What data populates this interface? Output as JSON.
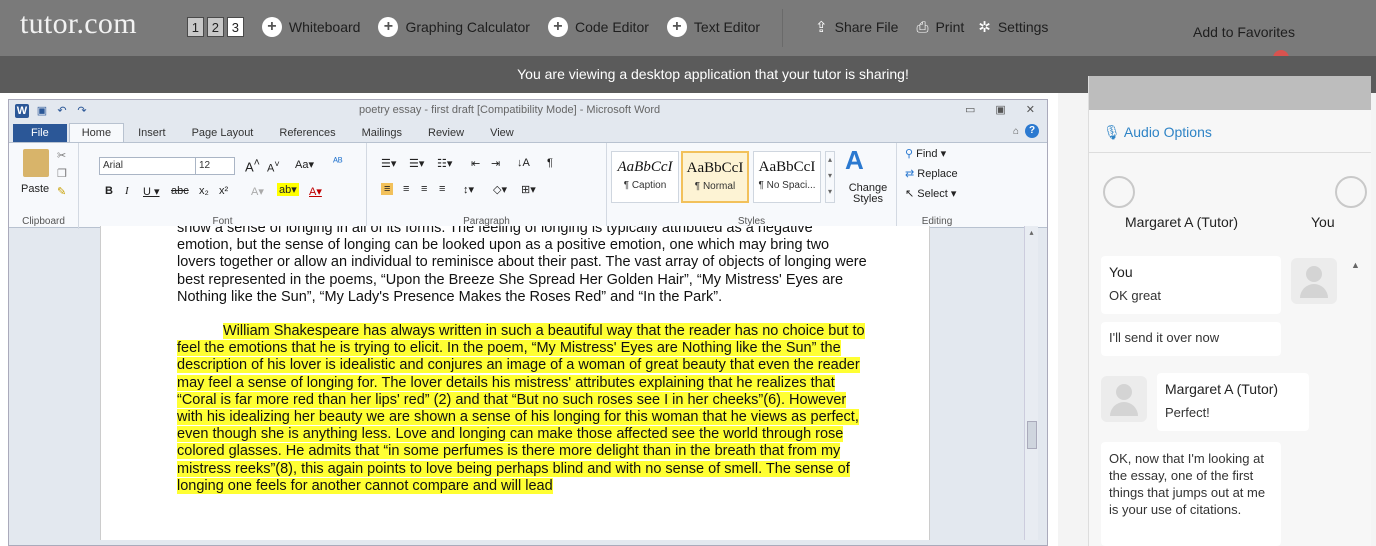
{
  "topbar": {
    "logo": "tutor.com",
    "pages": [
      "1",
      "2",
      "3"
    ],
    "tools": [
      "Whiteboard",
      "Graphing Calculator",
      "Code Editor",
      "Text Editor"
    ],
    "share_file": "Share File",
    "print": "Print",
    "settings": "Settings",
    "add_favorites": "Add to Favorites"
  },
  "share_message": "You are viewing a desktop application that your tutor is sharing!",
  "word": {
    "title": "poetry essay - first draft [Compatibility Mode] - Microsoft Word",
    "tabs": [
      "File",
      "Home",
      "Insert",
      "Page Layout",
      "References",
      "Mailings",
      "Review",
      "View"
    ],
    "ribbon": {
      "paste": "Paste",
      "clipboard": "Clipboard",
      "font_name": "Arial",
      "font_size": "12",
      "font": "Font",
      "paragraph": "Paragraph",
      "styles_label": "Styles",
      "styles": [
        {
          "sample": "AaBbCcI",
          "name": "¶ Caption"
        },
        {
          "sample": "AaBbCcI",
          "name": "¶ Normal"
        },
        {
          "sample": "AaBbCcI",
          "name": "¶ No Spaci..."
        }
      ],
      "change_styles": "Change Styles",
      "find": "Find",
      "replace": "Replace",
      "select": "Select",
      "editing": "Editing"
    },
    "doc": {
      "para1": "show a sense of longing in all of its forms. The feeling of longing is typically attributed as a negative emotion, but the sense of longing can be looked upon as a positive emotion, one which may bring two lovers together or allow an individual to reminisce about their past. The vast array of objects of longing were best represented in the poems, “Upon the Breeze She Spread Her Golden Hair”, “My Mistress' Eyes are Nothing like the Sun”, “My Lady's Presence Makes the Roses Red” and “In the Park”.",
      "para2": "William Shakespeare has always written in such a beautiful way that the reader has no choice but to feel the emotions that he is trying to elicit. In the poem, “My Mistress' Eyes are Nothing like the Sun” the description of his lover is idealistic and conjures an image of a woman of great beauty that even the reader may feel a sense of longing for. The lover details his mistress' attributes explaining that he realizes that “Coral is far more red than her lips' red” (2) and that “But no such roses see I in her cheeks”(6). However with his idealizing her beauty we are shown a sense of his longing for this woman that he views as perfect, even though she is anything less. Love and longing can make those affected see the world through rose colored glasses. He admits that “in some perfumes is there more delight than in the breath that from my mistress reeks”(8), this again points to love being perhaps blind and with no sense of smell. The sense of longing one feels for another cannot compare and will lead"
    }
  },
  "chat": {
    "audio_options": "Audio Options",
    "participants": [
      "Margaret A (Tutor)",
      "You"
    ],
    "messages": [
      {
        "sender": "You",
        "text": "OK great"
      },
      {
        "sender": "",
        "text": "I'll send it over now"
      },
      {
        "sender": "Margaret A (Tutor)",
        "text": "Perfect!"
      },
      {
        "sender": "",
        "text": "OK, now that I'm looking at the essay, one of the first things that jumps out at me is your use of citations."
      }
    ]
  }
}
